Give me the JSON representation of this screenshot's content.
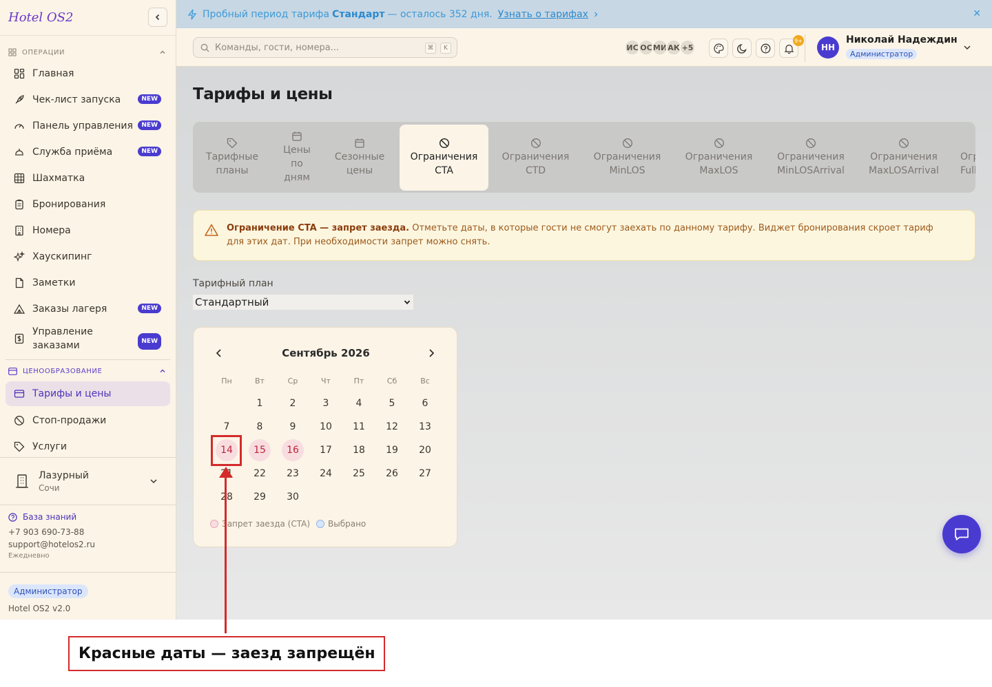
{
  "app": {
    "logo": "Hotel OS2"
  },
  "sidebar": {
    "operations_label": "ОПЕРАЦИИ",
    "pricing_label": "ЦЕНООБРАЗОВАНИЕ",
    "items": [
      {
        "label": "Главная"
      },
      {
        "label": "Чек-лист запуска",
        "badge": "NEW"
      },
      {
        "label": "Панель управления",
        "badge": "NEW"
      },
      {
        "label": "Служба приёма",
        "badge": "NEW"
      },
      {
        "label": "Шахматка"
      },
      {
        "label": "Бронирования"
      },
      {
        "label": "Номера"
      },
      {
        "label": "Хаускипинг"
      },
      {
        "label": "Заметки"
      },
      {
        "label": "Заказы лагеря",
        "badge": "NEW"
      },
      {
        "label": "Управление заказами",
        "badge": "NEW"
      }
    ],
    "pricing_items": [
      {
        "label": "Тарифы и цены"
      },
      {
        "label": "Стоп-продажи"
      },
      {
        "label": "Услуги"
      }
    ],
    "hotel": {
      "name": "Лазурный",
      "city": "Сочи"
    },
    "support": {
      "kb": "База знаний",
      "phone": "+7 903 690-73-88",
      "email": "support@hotelos2.ru",
      "hours": "Ежедневно"
    },
    "role": "Администратор",
    "version": "Hotel OS2 v2.0"
  },
  "banner": {
    "prefix": "Пробный период тарифа",
    "plan": "Стандарт",
    "suffix": "— осталось 352 дня.",
    "link": "Узнать о тарифах",
    "close": "✕"
  },
  "topbar": {
    "search_placeholder": "Команды, гости, номера...",
    "kbd1": "⌘",
    "kbd2": "K",
    "avatars": [
      "ИС",
      "ОС",
      "МИ",
      "АК",
      "+5"
    ],
    "notif_count": "9+",
    "user_initials": "НН",
    "user_name": "Николай Надеждин",
    "user_role": "Администратор"
  },
  "page": {
    "title": "Тарифы и цены"
  },
  "tabs": [
    {
      "line1": "Тарифные",
      "line2": "планы",
      "line3": "",
      "icon": "tag-icon"
    },
    {
      "line1": "Цены",
      "line2": "по",
      "line3": "дням",
      "icon": "calendar-icon"
    },
    {
      "line1": "Сезонные",
      "line2": "цены",
      "line3": "",
      "icon": "calendar-icon"
    },
    {
      "line1": "Ограничения",
      "line2": "CTA",
      "line3": "",
      "icon": "ban-icon",
      "active": true
    },
    {
      "line1": "Ограничения",
      "line2": "CTD",
      "line3": "",
      "icon": "ban-icon"
    },
    {
      "line1": "Ограничения",
      "line2": "MinLOS",
      "line3": "",
      "icon": "ban-icon"
    },
    {
      "line1": "Ограничения",
      "line2": "MaxLOS",
      "line3": "",
      "icon": "ban-icon"
    },
    {
      "line1": "Ограничения",
      "line2": "MinLOSArrival",
      "line3": "",
      "icon": "ban-icon"
    },
    {
      "line1": "Ограничения",
      "line2": "MaxLOSArrival",
      "line3": "",
      "icon": "ban-icon"
    },
    {
      "line1": "Ограничения",
      "line2": "FullPa",
      "line3": "",
      "icon": "ban-icon"
    }
  ],
  "alert": {
    "bold": "Ограничение CTA — запрет заезда.",
    "text1": "Отметьте даты, в которые гости не смогут заехать по данному тарифу. Виджет бронирования скроет тариф",
    "text2": "для этих дат. При необходимости запрет можно снять."
  },
  "rate_plan": {
    "label": "Тарифный план",
    "value": "Стандартный"
  },
  "calendar": {
    "title": "Сентябрь 2026",
    "weekdays": [
      "Пн",
      "Вт",
      "Ср",
      "Чт",
      "Пт",
      "Сб",
      "Вс"
    ],
    "first_weekday_index": 1,
    "days_in_month": 30,
    "cta_days": [
      14,
      15,
      16
    ],
    "legend_cta": "Запрет заезда (CTA)",
    "legend_selected": "Выбрано",
    "colors": {
      "cta_bg": "#f8dde0",
      "cta_text": "#c0243a",
      "selected": "#d6e6fb"
    }
  },
  "annotation": {
    "caption": "Красные даты — заезд запрещён"
  },
  "colors": {
    "accent": "#4a3bd0",
    "annotation": "#d42a2a"
  }
}
